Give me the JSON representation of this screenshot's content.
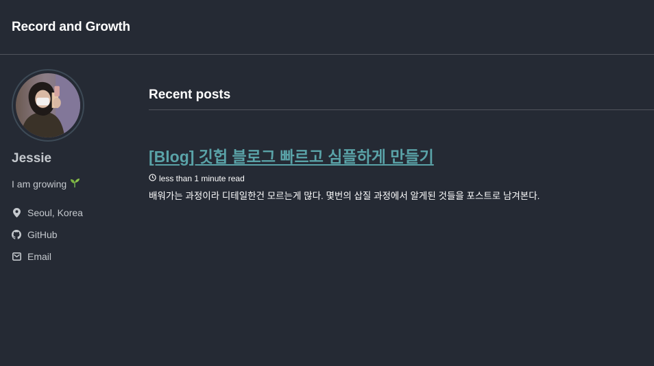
{
  "site": {
    "title": "Record and Growth"
  },
  "author": {
    "name": "Jessie",
    "bio": "I am growing",
    "bio_emoji": "seedling-icon",
    "links": [
      {
        "label": "Seoul, Korea",
        "icon": "map-marker-icon"
      },
      {
        "label": "GitHub",
        "icon": "github-icon"
      },
      {
        "label": "Email",
        "icon": "envelope-icon"
      }
    ]
  },
  "main": {
    "heading": "Recent posts",
    "posts": [
      {
        "title": "[Blog] 깃헙 블로그 빠르고 심플하게 만들기",
        "read_time": "less than 1 minute read",
        "excerpt": "배워가는 과정이라 디테일한건 모르는게 많다. 몇번의 삽질 과정에서 알게된 것들을 포스트로 남겨본다."
      }
    ]
  },
  "colors": {
    "background": "#252a34",
    "link": "#5aa3a8",
    "muted_text": "#c5c9ce",
    "divider": "#51555d"
  }
}
